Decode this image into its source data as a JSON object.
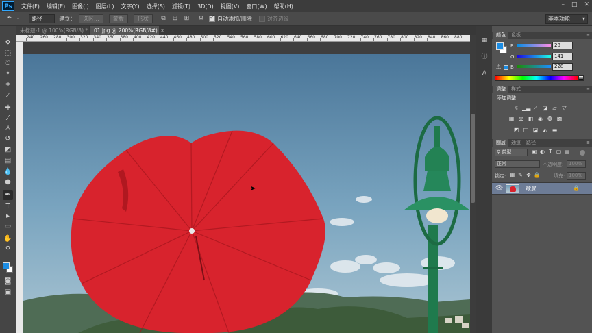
{
  "app": {
    "logo": "Ps"
  },
  "menu": [
    "文件(F)",
    "编辑(E)",
    "图像(I)",
    "图层(L)",
    "文字(Y)",
    "选择(S)",
    "滤镜(T)",
    "3D(D)",
    "视图(V)",
    "窗口(W)",
    "帮助(H)"
  ],
  "window_controls": {
    "minimize": "–",
    "maximize": "□",
    "close": "✕"
  },
  "options": {
    "tool_icon": "pen-icon",
    "mode_value": "路径",
    "make_label": "建立：",
    "selection_btn": "选区...",
    "mask_btn": "蒙版",
    "shape_btn": "形状",
    "auto_add_delete_label": "自动添加/删除",
    "auto_add_delete_checked": true,
    "align_edges_label": "对齐边缘",
    "align_edges_checked": false,
    "workspace": "基本功能"
  },
  "tabs": [
    {
      "label": "未标题-1 @ 100%(RGB/8) *",
      "close": "×",
      "active": false
    },
    {
      "label": "01.jpg @ 200%(RGB/8#)",
      "close": "×",
      "active": true
    }
  ],
  "ruler_ticks": [
    "240",
    "260",
    "280",
    "300",
    "320",
    "340",
    "360",
    "380",
    "400",
    "420",
    "440",
    "460",
    "480",
    "500",
    "520",
    "540",
    "560",
    "580",
    "600",
    "620",
    "640",
    "660",
    "680",
    "700",
    "720",
    "740",
    "760",
    "780",
    "800",
    "820",
    "840",
    "860",
    "880"
  ],
  "color_panel": {
    "tabs": [
      "颜色",
      "色板"
    ],
    "r_label": "R",
    "r_value": "28",
    "g_label": "G",
    "g_value": "141",
    "b_label": "B",
    "b_value": "228",
    "fg_color": "#1c8de4",
    "bg_color": "#ffffff"
  },
  "adjust_panel": {
    "tabs": [
      "调整",
      "样式"
    ],
    "title": "添加调整"
  },
  "layers_panel": {
    "tabs": [
      "图层",
      "通道",
      "路径"
    ],
    "filter_value": "类型",
    "blend_mode": "正常",
    "opacity_label": "不透明度:",
    "opacity_value": "100%",
    "lock_label": "锁定:",
    "fill_label": "填充:",
    "fill_value": "100%",
    "layer_name": "背景"
  },
  "colors": {
    "ui_dark": "#3c3c3c",
    "panel": "#535353",
    "accent_blue": "#1c8de4",
    "umbrella_red": "#d9252f",
    "lamp_green": "#1f7a4d",
    "sky": "#4e7fa3"
  }
}
